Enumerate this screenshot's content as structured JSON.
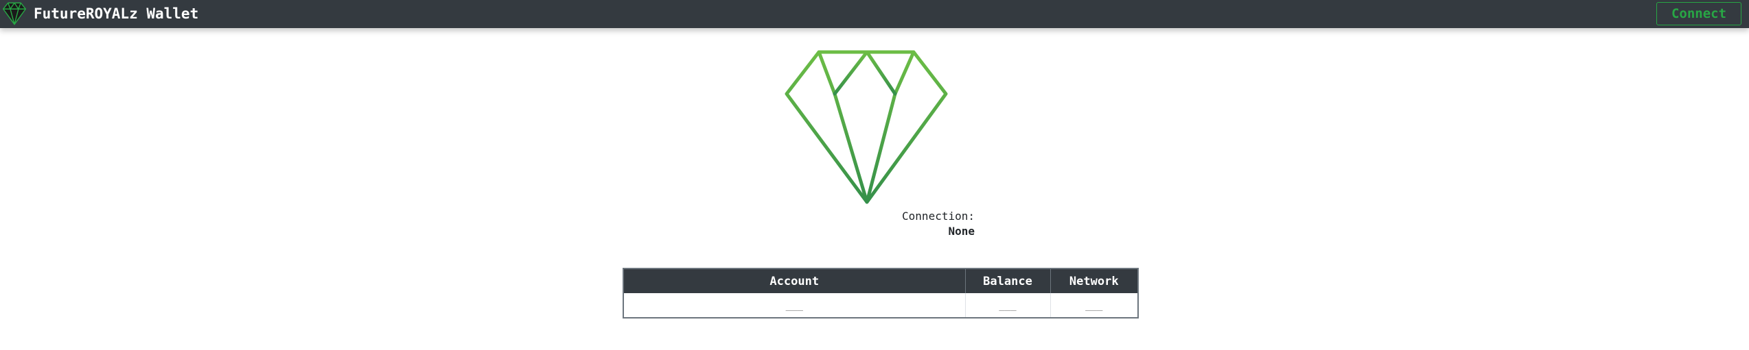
{
  "navbar": {
    "logo_icon": "diamond-icon",
    "title": "FutureROYALz Wallet",
    "connect_label": "Connect"
  },
  "hero": {
    "icon": "diamond-icon",
    "gradient_top": "#6cbd45",
    "gradient_bottom": "#35904a"
  },
  "connection": {
    "label": "Connection:",
    "value": "None"
  },
  "table": {
    "headers": [
      "Account",
      "Balance",
      "Network"
    ],
    "row": [
      "___",
      "___",
      "___"
    ]
  },
  "colors": {
    "navbar_bg": "#343a40",
    "accent": "#28a745"
  }
}
